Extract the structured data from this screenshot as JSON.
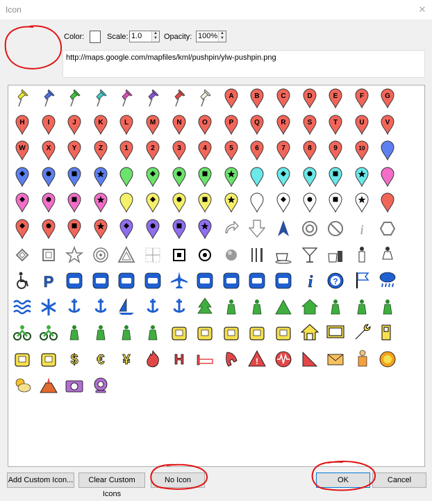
{
  "window": {
    "title": "Icon"
  },
  "toolbar": {
    "color_label": "Color:",
    "scale_label": "Scale:",
    "scale_value": "1.0",
    "opacity_label": "Opacity:",
    "opacity_value": "100%"
  },
  "url": "http://maps.google.com/mapfiles/kml/pushpin/ylw-pushpin.png",
  "buttons": {
    "add_custom": "Add Custom Icon...",
    "clear_custom": "Clear Custom Icons",
    "no_icon": "No Icon",
    "ok": "OK",
    "cancel": "Cancel"
  },
  "colors": {
    "red": "#f2665a",
    "blue": "#5c80f0",
    "green": "#6be36b",
    "cyan": "#6be8e8",
    "pink": "#f26ec8",
    "purple": "#8f6ef0",
    "yellow": "#f5f06a",
    "white": "#ffffff",
    "annotation": "#e01414",
    "icon_blue": "#1f5fd0"
  },
  "pushpins": [
    {
      "color": "#e8e832",
      "icon": "yellow-pushpin"
    },
    {
      "color": "#4a6ee8",
      "icon": "blue-pushpin"
    },
    {
      "color": "#39c539",
      "icon": "green-pushpin"
    },
    {
      "color": "#3fc9c9",
      "icon": "lightblue-pushpin"
    },
    {
      "color": "#d94fb5",
      "icon": "pink-pushpin"
    },
    {
      "color": "#8e4fd9",
      "icon": "purple-pushpin"
    },
    {
      "color": "#e04848",
      "icon": "red-pushpin"
    },
    {
      "color": "#f0f0e0",
      "icon": "white-pushpin"
    }
  ],
  "letters": [
    "A",
    "B",
    "C",
    "D",
    "E",
    "F",
    "G",
    "H",
    "I",
    "J",
    "K",
    "L",
    "M",
    "N",
    "O",
    "P",
    "Q",
    "R",
    "S",
    "T",
    "U",
    "V",
    "W",
    "X",
    "Y",
    "Z"
  ],
  "numbers": [
    "1",
    "2",
    "3",
    "4",
    "5",
    "6",
    "7",
    "8",
    "9",
    "10"
  ],
  "marker_groups": [
    {
      "color": "#5c80f0",
      "icon": "blue-paddle"
    },
    {
      "color": "#6be36b",
      "icon": "green-paddle"
    },
    {
      "color": "#6be8e8",
      "icon": "cyan-paddle"
    },
    {
      "color": "#f26ec8",
      "icon": "pink-paddle"
    },
    {
      "color": "#f5f06a",
      "icon": "yellow-paddle"
    },
    {
      "color": "#ffffff",
      "icon": "white-paddle"
    },
    {
      "color": "#f2665a",
      "icon": "red-paddle"
    },
    {
      "color": "#8f6ef0",
      "icon": "purple-paddle"
    }
  ],
  "shape_icons": [
    "arrow-reshare-icon",
    "arrow-down-icon",
    "navigation-arrow-icon",
    "target-circle-icon",
    "no-entry-icon",
    "info-i-icon",
    "hexagon-icon",
    "diamond-icon",
    "square-icon",
    "star-outline-icon",
    "bullseye-icon",
    "triangle-outline-icon",
    "crosshair-square-icon",
    "square-dot-icon",
    "circle-dot-icon",
    "grey-sphere-icon"
  ],
  "place_icons": [
    "dining-icon",
    "coffee-icon",
    "bar-icon",
    "snack-icon",
    "man-icon",
    "woman-icon",
    "wheelchair-icon",
    "parking-icon",
    "cab-icon",
    "bus-icon",
    "truck-icon",
    "rail-icon",
    "airport-icon",
    "ferry-icon",
    "heliport-icon",
    "subway-icon",
    "tram-icon",
    "info-icon",
    "help-icon",
    "flag-icon",
    "rain-icon",
    "water-icon",
    "snowflake-icon",
    "marina-icon",
    "fishing-icon",
    "sailing-icon",
    "swimming-icon",
    "skiing-icon",
    "parks-icon",
    "campfire-icon",
    "picnic-icon",
    "camping-icon",
    "ranger-station-icon",
    "toilets-icon",
    "poi-icon",
    "hiker-icon",
    "cycling-icon",
    "motorbike-icon",
    "horse-icon",
    "golf-icon",
    "play-icon",
    "movies-icon",
    "shopping-icon",
    "camera-shop-icon",
    "grocery-icon",
    "basket-icon",
    "theater-icon",
    "home-icon",
    "tv-icon",
    "mechanic-icon",
    "gas-station-icon",
    "lodging-icon",
    "convenience-icon",
    "dollar-icon",
    "euro-icon",
    "yen-icon",
    "fire-icon",
    "hospital-icon",
    "bed-icon",
    "phone-icon",
    "caution-icon",
    "earthquake-icon",
    "falling-rocks-icon",
    "post-office-icon",
    "police-icon",
    "sunny-icon",
    "partly-cloudy-icon",
    "volcano-icon",
    "camera-icon",
    "webcam-icon"
  ],
  "place_glyphs": {
    "dollar-icon": "$",
    "euro-icon": "€",
    "yen-icon": "¥"
  }
}
